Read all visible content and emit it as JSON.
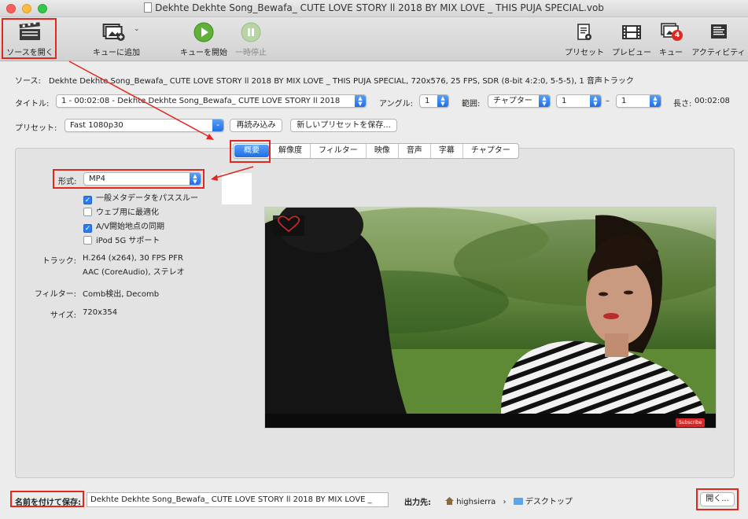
{
  "window": {
    "title": "Dekhte Dekhte Song_Bewafa_ CUTE LOVE STORY ll 2018 BY MIX LOVE _ THIS PUJA SPECIAL.vob"
  },
  "toolbar": {
    "open_source": "ソースを開く",
    "add_to_queue": "キューに追加",
    "start_queue": "キューを開始",
    "pause": "一時停止",
    "presets": "プリセット",
    "preview": "プレビュー",
    "queue": "キュー",
    "queue_badge": "4",
    "activity": "アクティビティ"
  },
  "source": {
    "label": "ソース:",
    "value": "Dekhte Dekhte Song_Bewafa_ CUTE LOVE STORY ll 2018 BY MIX LOVE _ THIS PUJA SPECIAL, 720x576, 25 FPS, SDR (8-bit 4:2:0, 5-5-5), 1 音声トラック"
  },
  "title_row": {
    "label": "タイトル:",
    "value": "1 - 00:02:08 - Dekhte Dekhte Song_Bewafa_ CUTE LOVE STORY ll 2018",
    "angle_label": "アングル:",
    "angle_value": "1",
    "range_label": "範囲:",
    "range_type": "チャプター",
    "range_start": "1",
    "range_dash": "–",
    "range_end": "1",
    "duration_label": "長さ:",
    "duration_value": "00:02:08"
  },
  "preset_row": {
    "label": "プリセット:",
    "value": "Fast 1080p30",
    "reload": "再読み込み",
    "save_new": "新しいプリセットを保存..."
  },
  "tabs": [
    "概要",
    "解像度",
    "フィルター",
    "映像",
    "音声",
    "字幕",
    "チャプター"
  ],
  "summary": {
    "format_label": "形式:",
    "format_value": "MP4",
    "checkboxes": [
      {
        "label": "一般メタデータをパススルー",
        "checked": true
      },
      {
        "label": "ウェブ用に最適化",
        "checked": false
      },
      {
        "label": "A/V開始地点の同期",
        "checked": true
      },
      {
        "label": "iPod 5G サポート",
        "checked": false
      }
    ],
    "tracks_label": "トラック:",
    "tracks_line1": "H.264 (x264), 30 FPS PFR",
    "tracks_line2": "AAC (CoreAudio), ステレオ",
    "filters_label": "フィルター:",
    "filters_value": "Comb検出, Decomb",
    "size_label": "サイズ:",
    "size_value": "720x354"
  },
  "preview": {
    "subscribe": "Subscribe"
  },
  "bottom": {
    "save_as_label": "名前を付けて保存:",
    "save_as_value": "Dekhte Dekhte Song_Bewafa_ CUTE LOVE STORY ll 2018 BY MIX LOVE _",
    "dest_label": "出力先:",
    "dest_home": "highsierra",
    "dest_sep": "›",
    "dest_folder": "デスクトップ",
    "browse": "開く..."
  },
  "colors": {
    "accent": "#1f6ee6",
    "highlight_box": "#e0281f",
    "badge": "#e0281f"
  }
}
